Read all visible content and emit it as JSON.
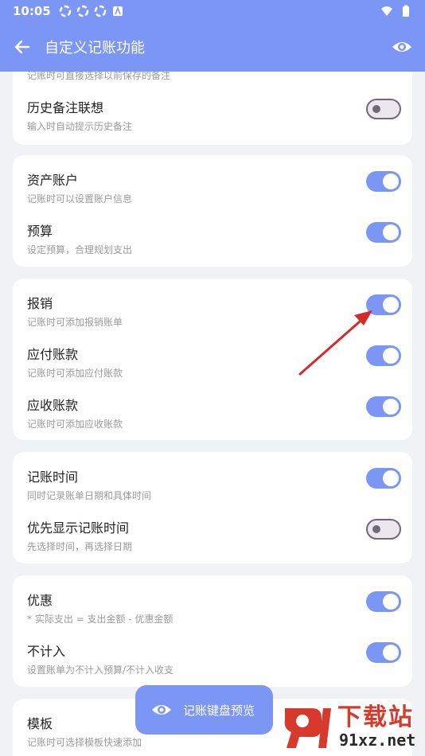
{
  "status": {
    "time": "10:05"
  },
  "appbar": {
    "title": "自定义记账功能"
  },
  "cards": [
    {
      "rows": [
        {
          "title": "",
          "subtitle": "记账时可直接选择以前保存的备注",
          "on": true
        },
        {
          "title": "历史备注联想",
          "subtitle": "输入时自动提示历史备注",
          "on": false
        }
      ]
    },
    {
      "rows": [
        {
          "title": "资产账户",
          "subtitle": "记账时可以设置账户信息",
          "on": true
        },
        {
          "title": "预算",
          "subtitle": "设定预算，合理规划支出",
          "on": true
        }
      ]
    },
    {
      "rows": [
        {
          "title": "报销",
          "subtitle": "记账时可添加报销账单",
          "on": true
        },
        {
          "title": "应付账款",
          "subtitle": "记账时可添加应付账款",
          "on": true
        },
        {
          "title": "应收账款",
          "subtitle": "记账时可添加应收账款",
          "on": true
        }
      ]
    },
    {
      "rows": [
        {
          "title": "记账时间",
          "subtitle": "同时记录账单日期和具体时间",
          "on": true
        },
        {
          "title": "优先显示记账时间",
          "subtitle": "先选择时间，再选择日期",
          "on": false
        }
      ]
    },
    {
      "rows": [
        {
          "title": "优惠",
          "subtitle": "* 实际支出 = 支出金额 - 优惠金额",
          "on": true
        },
        {
          "title": "不计入",
          "subtitle": "设置账单为不计入预算/不计入收支",
          "on": true
        }
      ]
    },
    {
      "rows": [
        {
          "title": "模板",
          "subtitle": "记账时可选择模板快速添加",
          "on": true
        }
      ]
    }
  ],
  "fab": {
    "label": "记账键盘预览"
  },
  "watermark": {
    "text": "下载站",
    "url": "91xz.net"
  },
  "colors": {
    "accent": "#7b96f5",
    "arrow": "#d42a2a"
  }
}
